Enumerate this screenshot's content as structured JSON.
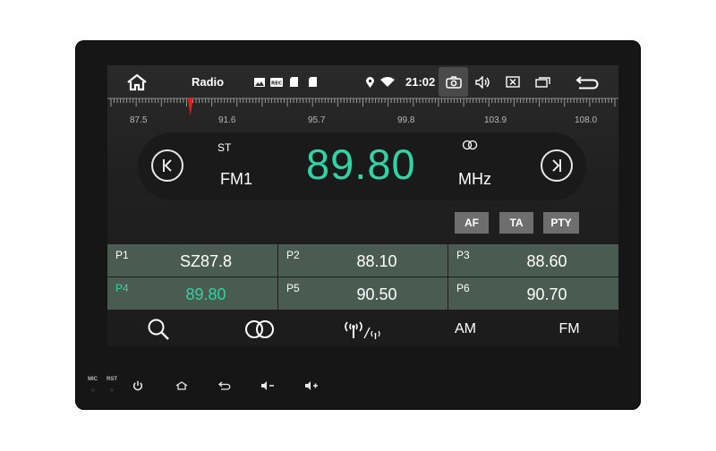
{
  "status_bar": {
    "app_title": "Radio",
    "clock": "21:02",
    "icons": [
      "home-icon",
      "gallery-icon",
      "rec-icon",
      "sd-card-icon",
      "sd-card-icon",
      "location-icon",
      "wifi-icon",
      "camera-icon",
      "volume-icon",
      "close-window-icon",
      "windows-icon",
      "back-icon"
    ]
  },
  "scale": {
    "labels": [
      "87.5",
      "91.6",
      "95.7",
      "99.8",
      "103.9",
      "108.0"
    ],
    "marker_freq": 89.8
  },
  "tuner": {
    "stereo_indicator": "ST",
    "band": "FM1",
    "frequency": "89.80",
    "unit": "MHz"
  },
  "options": {
    "af": "AF",
    "ta": "TA",
    "pty": "PTY"
  },
  "presets": [
    {
      "num": "P1",
      "value": "SZ87.8",
      "active": false
    },
    {
      "num": "P2",
      "value": "88.10",
      "active": false
    },
    {
      "num": "P3",
      "value": "88.60",
      "active": false
    },
    {
      "num": "P4",
      "value": "89.80",
      "active": true
    },
    {
      "num": "P5",
      "value": "90.50",
      "active": false
    },
    {
      "num": "P6",
      "value": "90.70",
      "active": false
    }
  ],
  "toolbar": {
    "am": "AM",
    "fm": "FM"
  },
  "hardware": {
    "mic": "MIC",
    "rst": "RST"
  },
  "colors": {
    "accent": "#2fd3a4",
    "marker": "#e02020",
    "preset_bg": "#4a5c52"
  }
}
